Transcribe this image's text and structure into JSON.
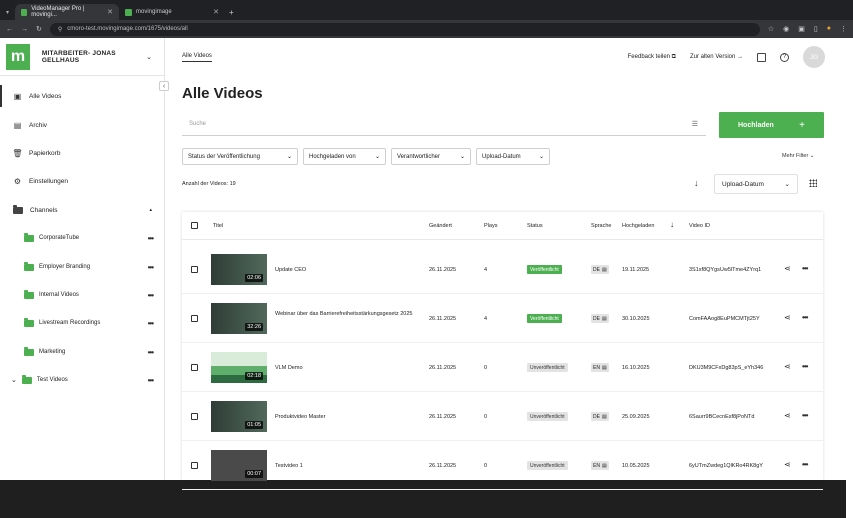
{
  "browser": {
    "tabs": [
      {
        "title": "VideoManager Pro | movingi..."
      },
      {
        "title": "movingimage"
      }
    ],
    "url": "cmoro-test.movingimage.com/1675/videos/all"
  },
  "sidebar": {
    "user": "MITARBEITER- JONAS GELLHAUS",
    "items": [
      {
        "label": "Alle Videos",
        "icon": "video-icon"
      },
      {
        "label": "Archiv",
        "icon": "archive-icon"
      },
      {
        "label": "Papierkorb",
        "icon": "trash-icon"
      },
      {
        "label": "Einstellungen",
        "icon": "gear-icon"
      },
      {
        "label": "Channels",
        "icon": "folder-icon"
      }
    ],
    "channels": [
      {
        "label": "CorporateTube"
      },
      {
        "label": "Employer Branding"
      },
      {
        "label": "Internal Videos"
      },
      {
        "label": "Livestream Recordings"
      },
      {
        "label": "Marketing"
      },
      {
        "label": "Test Videos"
      }
    ]
  },
  "topbar": {
    "breadcrumb": "Alle Videos",
    "feedback": "Feedback teilen",
    "old_version": "Zur alten Version",
    "avatar": "JG"
  },
  "main": {
    "title": "Alle Videos",
    "search_placeholder": "Suche",
    "upload_label": "Hochladen",
    "filters": [
      {
        "label": "Status der Veröffentlichung"
      },
      {
        "label": "Hochgeladen von"
      },
      {
        "label": "Verantwortlicher"
      },
      {
        "label": "Upload-Datum"
      }
    ],
    "more_filters": "Mehr Filter",
    "count": "Anzahl der Videos: 19",
    "sort_value": "Upload-Datum"
  },
  "table": {
    "headers": {
      "title": "Titel",
      "changed": "Geändert",
      "plays": "Plays",
      "status": "Status",
      "language": "Sprache",
      "uploaded": "Hochgeladen",
      "video_id": "Video ID"
    },
    "rows": [
      {
        "title": "Update CEO",
        "duration": "02:06",
        "changed": "26.11.2025",
        "plays": "4",
        "status": "Veröffentlicht",
        "status_kind": "pub",
        "lang": "DE",
        "uploaded": "19.11.2025",
        "video_id": "3S1xf8QYgsUw5lTme4ZYrq1"
      },
      {
        "title": "Webinar über das Barrierefreiheitsstärkungsgesetz 2025",
        "duration": "32:26",
        "changed": "26.11.2025",
        "plays": "4",
        "status": "Veröffentlicht",
        "status_kind": "pub",
        "lang": "DE",
        "uploaded": "30.10.2025",
        "video_id": "ComFAAog8EuPMCMTjt25Y"
      },
      {
        "title": "VLM Demo",
        "duration": "02:18",
        "changed": "26.11.2025",
        "plays": "0",
        "status": "Unveröffentlicht",
        "status_kind": "unpub",
        "lang": "EN",
        "uploaded": "16.10.2025",
        "video_id": "DKU3M9CFxDg83pS_eYh346"
      },
      {
        "title": "Produktvideo Master",
        "duration": "01:05",
        "changed": "26.11.2025",
        "plays": "0",
        "status": "Unveröffentlicht",
        "status_kind": "unpub",
        "lang": "DE",
        "uploaded": "25.09.2025",
        "video_id": "6Saurr9BCecnEsf8jPoNTd"
      },
      {
        "title": "Testvideo 1",
        "duration": "00:07",
        "changed": "26.11.2025",
        "plays": "0",
        "status": "Unveröffentlicht",
        "status_kind": "unpub",
        "lang": "EN",
        "uploaded": "10.05.2025",
        "video_id": "6yUTmZwdeg1QlKRo4RK8gY"
      }
    ]
  },
  "colors": {
    "accent": "#4caf50"
  }
}
